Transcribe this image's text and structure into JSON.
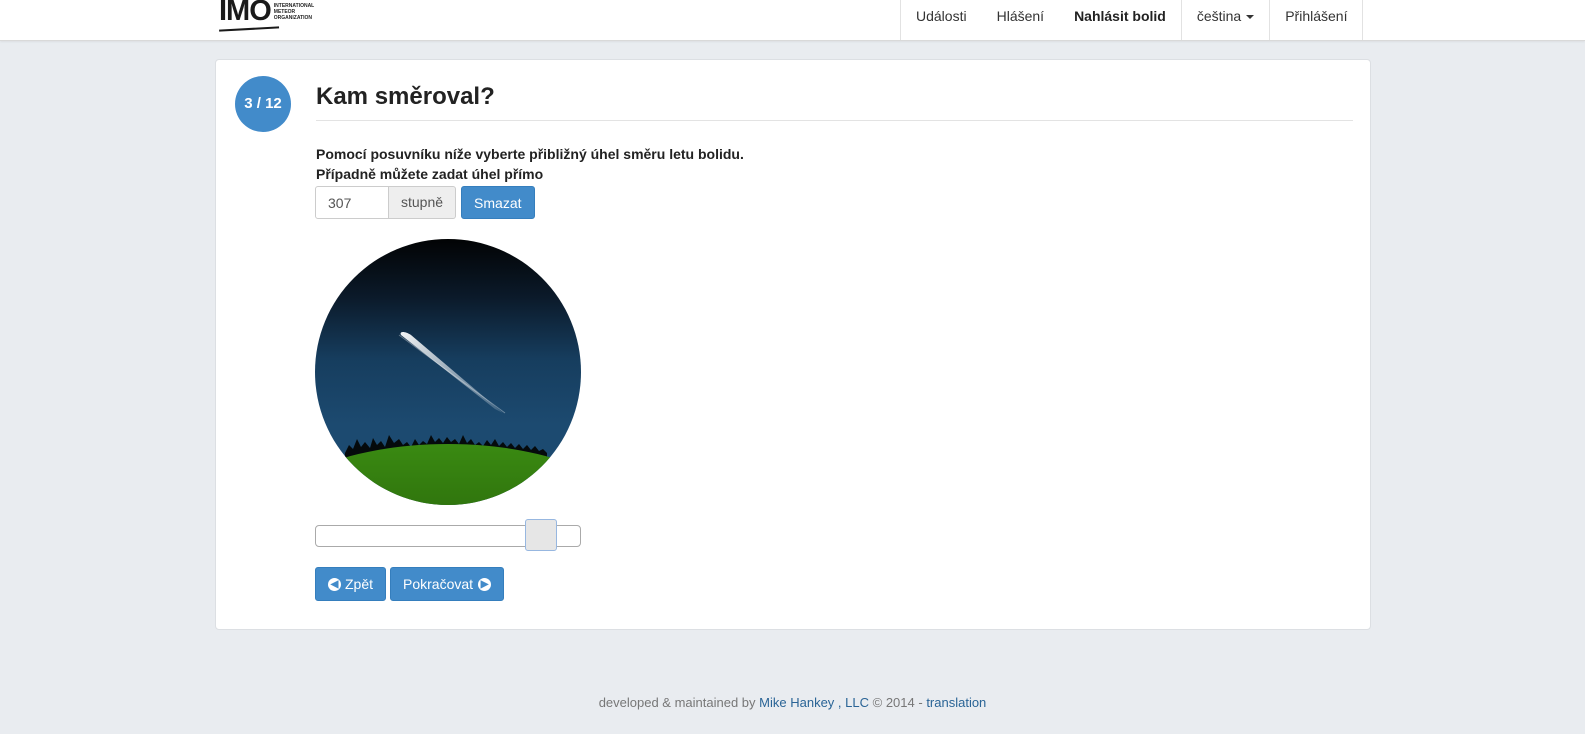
{
  "navbar": {
    "logo_text": "IMO",
    "logo_subtitle": [
      "INTERNATIONAL",
      "METEOR",
      "ORGANIZATION"
    ],
    "items": [
      {
        "label": "Události"
      },
      {
        "label": "Hlášení"
      },
      {
        "label": "Nahlásit bolid"
      },
      {
        "label": "čeština"
      },
      {
        "label": "Přihlášení"
      }
    ]
  },
  "step": {
    "badge": "3 / 12",
    "title": "Kam směroval?"
  },
  "instructions": {
    "line1": "Pomocí posuvníku níže vyberte přibližný úhel směru letu bolidu.",
    "line2": "Případně můžete zadat úhel přímo"
  },
  "angle": {
    "value": "307",
    "unit": "stupně",
    "clear_label": "Smazat",
    "slider_fraction": 0.853
  },
  "nav_buttons": {
    "back_label": "Zpět",
    "next_label": "Pokračovat"
  },
  "footer": {
    "prefix": "developed & maintained by",
    "author": "Mike Hankey",
    "company": ", LLC",
    "copyright": "© 2014 -",
    "translation": "translation"
  },
  "colors": {
    "primary": "#428bca",
    "background": "#e9ecf0",
    "ground": "#2a6e0a"
  },
  "icons": {
    "back": "circle-arrow-left-icon",
    "next": "circle-arrow-right-icon"
  }
}
